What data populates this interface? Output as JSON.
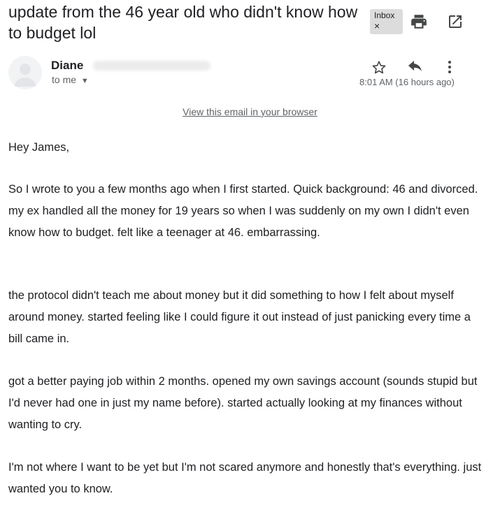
{
  "email": {
    "subject": "update from the 46 year old who didn't know how to budget lol",
    "label_chip": "Inbox",
    "label_remove": "×",
    "sender_name": "Diane",
    "recipient": "to me",
    "recipient_caret": "▼",
    "timestamp": "8:01 AM (16 hours ago)",
    "view_in_browser": "View this email in your browser",
    "greeting": "Hey James,",
    "paragraphs": [
      "So I wrote to you a few months ago when I first started. Quick background: 46 and divorced. my ex handled all the money for 19 years so when I was suddenly on my own I didn't even know how to budget. felt like a teenager at 46. embarrassing.",
      "the protocol didn't teach me about money but it did something to how I felt about myself around money. started feeling like I could figure it out instead of just panicking every time a bill came in.",
      "got a better paying job within 2 months. opened my own savings account (sounds stupid but I'd never had one in just my name before). started actually looking at my finances without wanting to cry.",
      "I'm not where I want to be yet but I'm not scared anymore and honestly that's everything. just wanted you to know."
    ]
  },
  "icons": {
    "print": "print-icon",
    "open_in_new_window": "popout-icon",
    "star": "star-icon",
    "reply": "reply-icon",
    "more": "more-vert-icon",
    "avatar": "avatar-icon"
  },
  "colors": {
    "text_primary": "#202124",
    "text_secondary": "#5f6368",
    "chip_background": "#dcdcdc",
    "avatar_background": "#f1f3f4"
  }
}
